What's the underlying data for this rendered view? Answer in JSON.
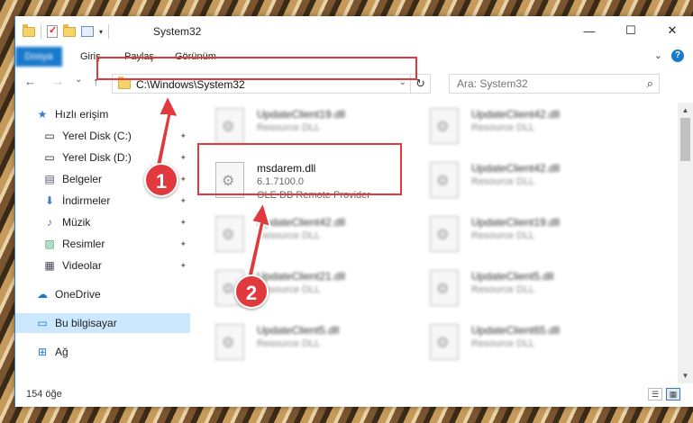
{
  "window": {
    "title": "System32",
    "controls": {
      "minimize": "—",
      "maximize": "☐",
      "close": "✕"
    }
  },
  "ribbon": {
    "tabs": [
      "Dosya",
      "Giriş",
      "Paylaş",
      "Görünüm"
    ],
    "expand_icon": "chevron-down-icon",
    "help_label": "?"
  },
  "nav": {
    "back": "←",
    "forward": "→",
    "recent": "⌄",
    "up": "↑",
    "address": "C:\\Windows\\System32",
    "refresh": "↻",
    "search_placeholder": "Ara: System32",
    "search_icon": "⌕"
  },
  "sidebar": {
    "items": [
      {
        "label": "Hızlı erişim",
        "icon": "★",
        "pinned": false
      },
      {
        "label": "Yerel Disk (C:)",
        "icon": "▭",
        "pinned": true
      },
      {
        "label": "Yerel Disk (D:)",
        "icon": "▭",
        "pinned": true
      },
      {
        "label": "Belgeler",
        "icon": "▤",
        "pinned": true
      },
      {
        "label": "İndirmeler",
        "icon": "⬇",
        "pinned": true
      },
      {
        "label": "Müzik",
        "icon": "♪",
        "pinned": true
      },
      {
        "label": "Resimler",
        "icon": "▨",
        "pinned": true
      },
      {
        "label": "Videolar",
        "icon": "▦",
        "pinned": true
      },
      {
        "label": "OneDrive",
        "icon": "☁",
        "pinned": false
      },
      {
        "label": "Bu bilgisayar",
        "icon": "▭",
        "pinned": false
      },
      {
        "label": "Ağ",
        "icon": "⊞",
        "pinned": false
      }
    ],
    "pin_glyph": "📌"
  },
  "files": {
    "left": [
      {
        "name": "UpdateClient19.dll",
        "type": "Resource DLL"
      },
      {
        "name": "msdarem.dll",
        "version": "6.1.7100.0",
        "description": "OLE DB Remote Provider"
      },
      {
        "name": "UpdateClient42.dll",
        "type": "Resource DLL"
      },
      {
        "name": "UpdateClient21.dll",
        "type": "Resource DLL"
      },
      {
        "name": "UpdateClient5.dll",
        "type": "Resource DLL"
      }
    ],
    "right": [
      {
        "name": "UpdateClient42.dll",
        "type": "Resource DLL"
      },
      {
        "name": "UpdateClient42.dll",
        "type": "Resource DLL"
      },
      {
        "name": "UpdateClient19.dll",
        "type": "Resource DLL"
      },
      {
        "name": "UpdateClient5.dll",
        "type": "Resource DLL"
      },
      {
        "name": "UpdateClient65.dll",
        "type": "Resource DLL"
      }
    ]
  },
  "status": {
    "count": "154 öğe"
  },
  "annotations": {
    "step1": "1",
    "step2": "2",
    "color": "#e0393e"
  }
}
